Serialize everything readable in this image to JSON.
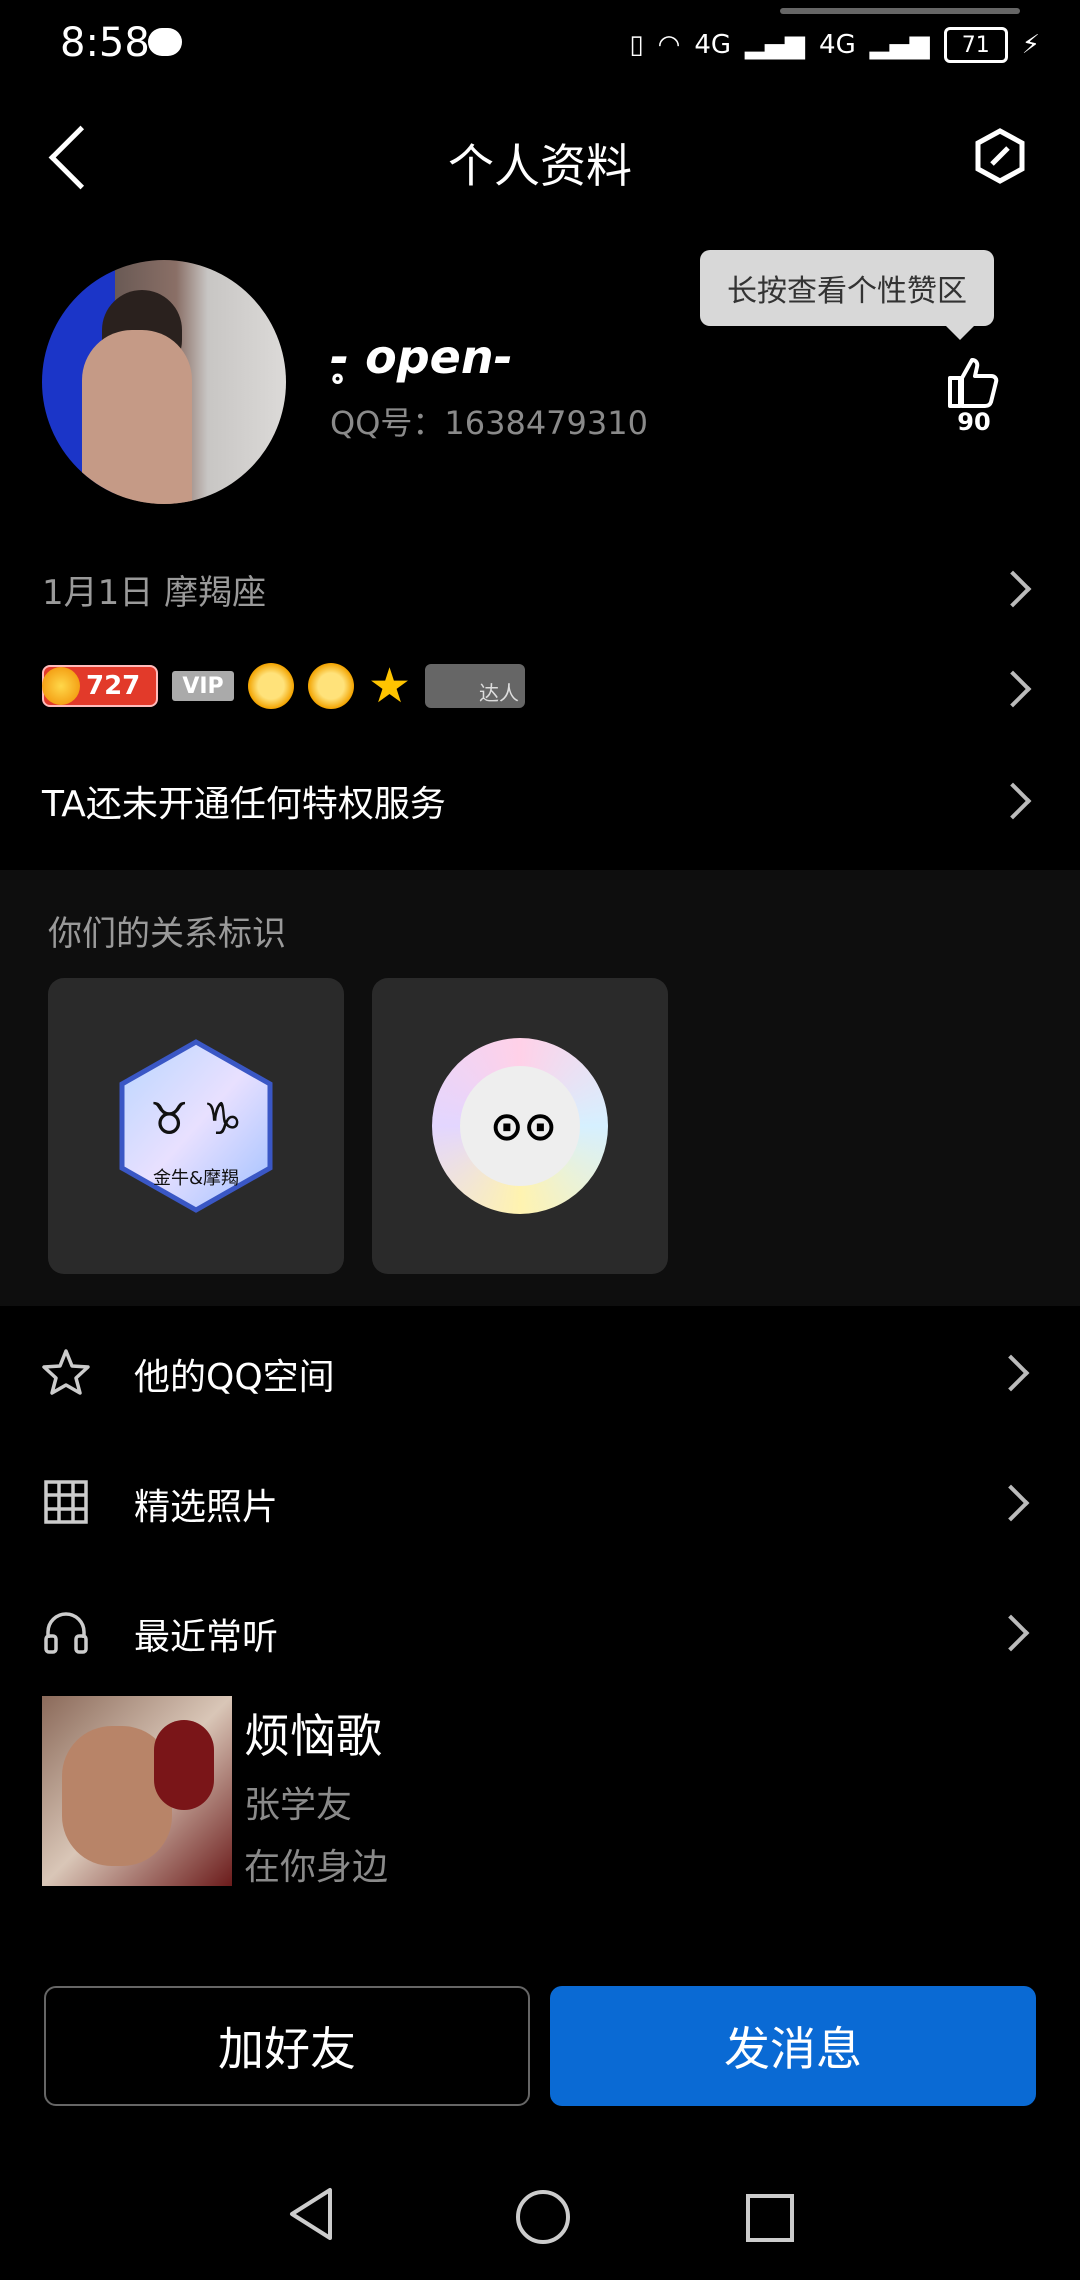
{
  "status_bar": {
    "time": "8:58",
    "network_1": "4G",
    "network_2": "4G",
    "battery": "71"
  },
  "header": {
    "title": "个人资料"
  },
  "profile": {
    "nickname": "-̥ open- ",
    "qq_label": "QQ号：1638479310",
    "tooltip": "长按查看个性赞区",
    "like_count": "90"
  },
  "info": {
    "birthday": "1月1日  摩羯座",
    "level": "727",
    "vip": "VIP",
    "daren": "达人",
    "privilege": "TA还未开通任何特权服务"
  },
  "relation": {
    "label": "你们的关系标识",
    "badge1_text": "金牛&摩羯",
    "badge1_symbols": "♉ ♑",
    "badge2_face": "⊙⊙"
  },
  "menu": {
    "qzone": "他的QQ空间",
    "photos": "精选照片",
    "music": "最近常听"
  },
  "music": {
    "song": "烦恼歌",
    "artist": "张学友",
    "album": "在你身边"
  },
  "actions": {
    "add_friend": "加好友",
    "send_message": "发消息"
  },
  "colors": {
    "accent": "#0a6ad4",
    "background": "#000000"
  }
}
